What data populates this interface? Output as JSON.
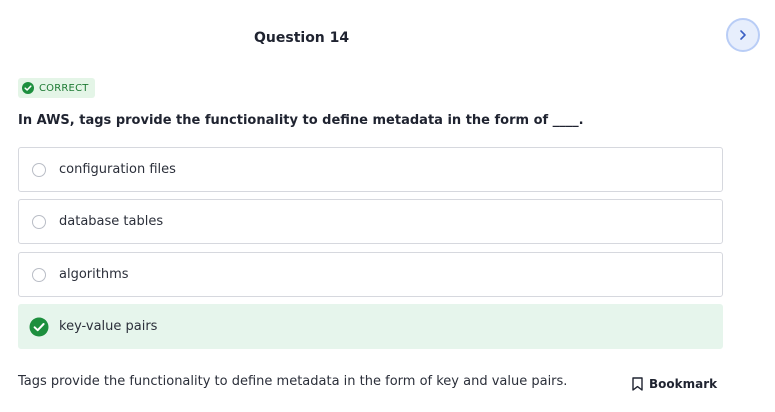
{
  "question": {
    "title": "Question 14",
    "status": "CORRECT",
    "text": "In AWS, tags provide the functionality to define metadata in the form of ____.",
    "options": [
      {
        "label": "configuration files",
        "correct": false
      },
      {
        "label": "database tables",
        "correct": false
      },
      {
        "label": "algorithms",
        "correct": false
      },
      {
        "label": "key-value pairs",
        "correct": true
      }
    ],
    "explanation": "Tags provide the functionality to define metadata in the form of key and value pairs."
  },
  "actions": {
    "bookmark_label": "Bookmark"
  },
  "icons": {
    "next": "chevron-right-icon",
    "status": "check-circle-icon",
    "correct_option": "check-circle-icon",
    "bookmark": "bookmark-icon"
  },
  "colors": {
    "correct_green": "#1d8f3e",
    "correct_bg": "#e6f5ec",
    "next_btn_bg": "#e7eefc"
  }
}
